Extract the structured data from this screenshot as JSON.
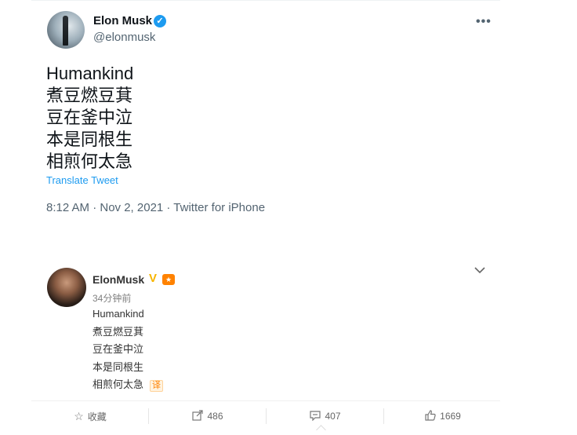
{
  "tweet": {
    "author_name": "Elon Musk",
    "handle": "@elonmusk",
    "more_label": "•••",
    "lines": [
      "Humankind",
      "煮豆燃豆萁",
      "豆在釜中泣",
      "本是同根生",
      "相煎何太急"
    ],
    "translate_label": "Translate Tweet",
    "meta": "8:12 AM · Nov 2, 2021 · Twitter for iPhone"
  },
  "weibo": {
    "author_name": "ElonMusk",
    "verified_mark": "V",
    "badge": "★",
    "time": "34分钟前",
    "lines": [
      "Humankind",
      "煮豆燃豆萁",
      "豆在釜中泣",
      "本是同根生",
      "相煎何太急"
    ],
    "translate_tag": "译",
    "actions": {
      "favorite_label": "收藏",
      "repost_count": "486",
      "comment_count": "407",
      "like_count": "1669"
    }
  },
  "colors": {
    "twitter_blue": "#1d9bf0",
    "weibo_orange": "#ff8200",
    "verified_gold": "#f7b500"
  },
  "icons": [
    "verified-icon",
    "more-icon",
    "chevron-down-icon",
    "star-icon",
    "repost-icon",
    "comment-icon",
    "like-icon"
  ]
}
